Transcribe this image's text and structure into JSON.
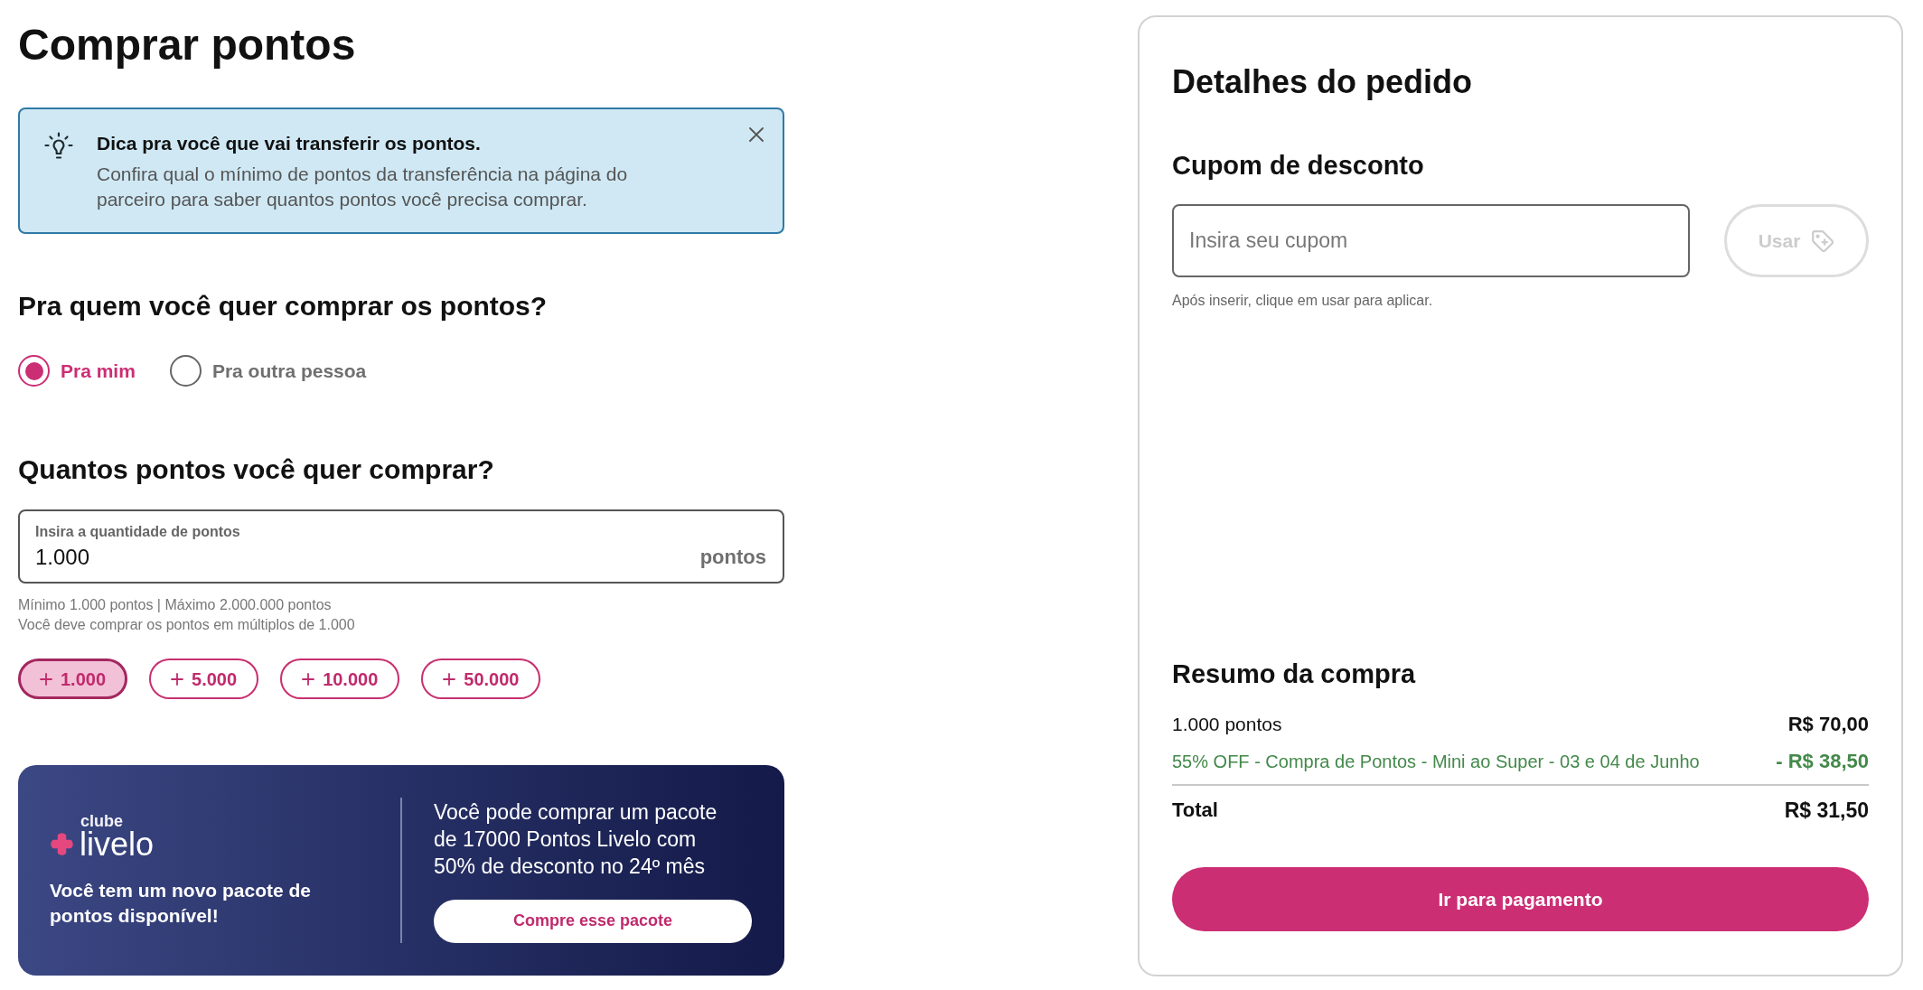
{
  "page_title": "Comprar pontos",
  "tip": {
    "title": "Dica pra você que vai transferir os pontos.",
    "text": "Confira qual o mínimo de pontos da transferência na página do parceiro para saber quantos pontos você precisa comprar.",
    "dismissible": true
  },
  "recipient": {
    "question": "Pra quem você quer comprar os pontos?",
    "options": [
      {
        "label": "Pra mim",
        "selected": true
      },
      {
        "label": "Pra outra pessoa",
        "selected": false
      }
    ]
  },
  "quantity": {
    "question": "Quantos pontos você quer comprar?",
    "field": {
      "label": "Insira a quantidade de pontos",
      "value": "1.000",
      "unit": "pontos"
    },
    "hints": [
      "Mínimo 1.000 pontos | Máximo 2.000.000 pontos",
      "Você deve comprar os pontos em múltiplos de 1.000"
    ],
    "increments": [
      {
        "label": "1.000",
        "selected": true
      },
      {
        "label": "5.000",
        "selected": false
      },
      {
        "label": "10.000",
        "selected": false
      },
      {
        "label": "50.000",
        "selected": false
      }
    ]
  },
  "promo_banner": {
    "logo": {
      "top": "clube",
      "wordmark": "livelo"
    },
    "headline": "Você tem um novo pacote de pontos disponível!",
    "text": "Você pode comprar um pacote de 17000 Pontos Livelo com 50% de desconto no 24º mês",
    "button": "Compre esse pacote"
  },
  "order_details": {
    "title": "Detalhes do pedido",
    "coupon": {
      "heading": "Cupom de desconto",
      "placeholder": "Insira seu cupom",
      "button": {
        "label": "Usar",
        "disabled": true
      },
      "hint": "Após inserir, clique em usar para aplicar."
    },
    "summary": {
      "heading": "Resumo da compra",
      "lines": [
        {
          "kind": "item",
          "label": "1.000 pontos",
          "amount": "R$ 70,00"
        },
        {
          "kind": "discount",
          "label": "55% OFF - Compra de Pontos - Mini ao Super - 03 e 04 de Junho",
          "amount": "- R$ 38,50"
        }
      ],
      "total": {
        "label": "Total",
        "amount": "R$ 31,50"
      }
    },
    "pay_button": "Ir para pagamento"
  }
}
